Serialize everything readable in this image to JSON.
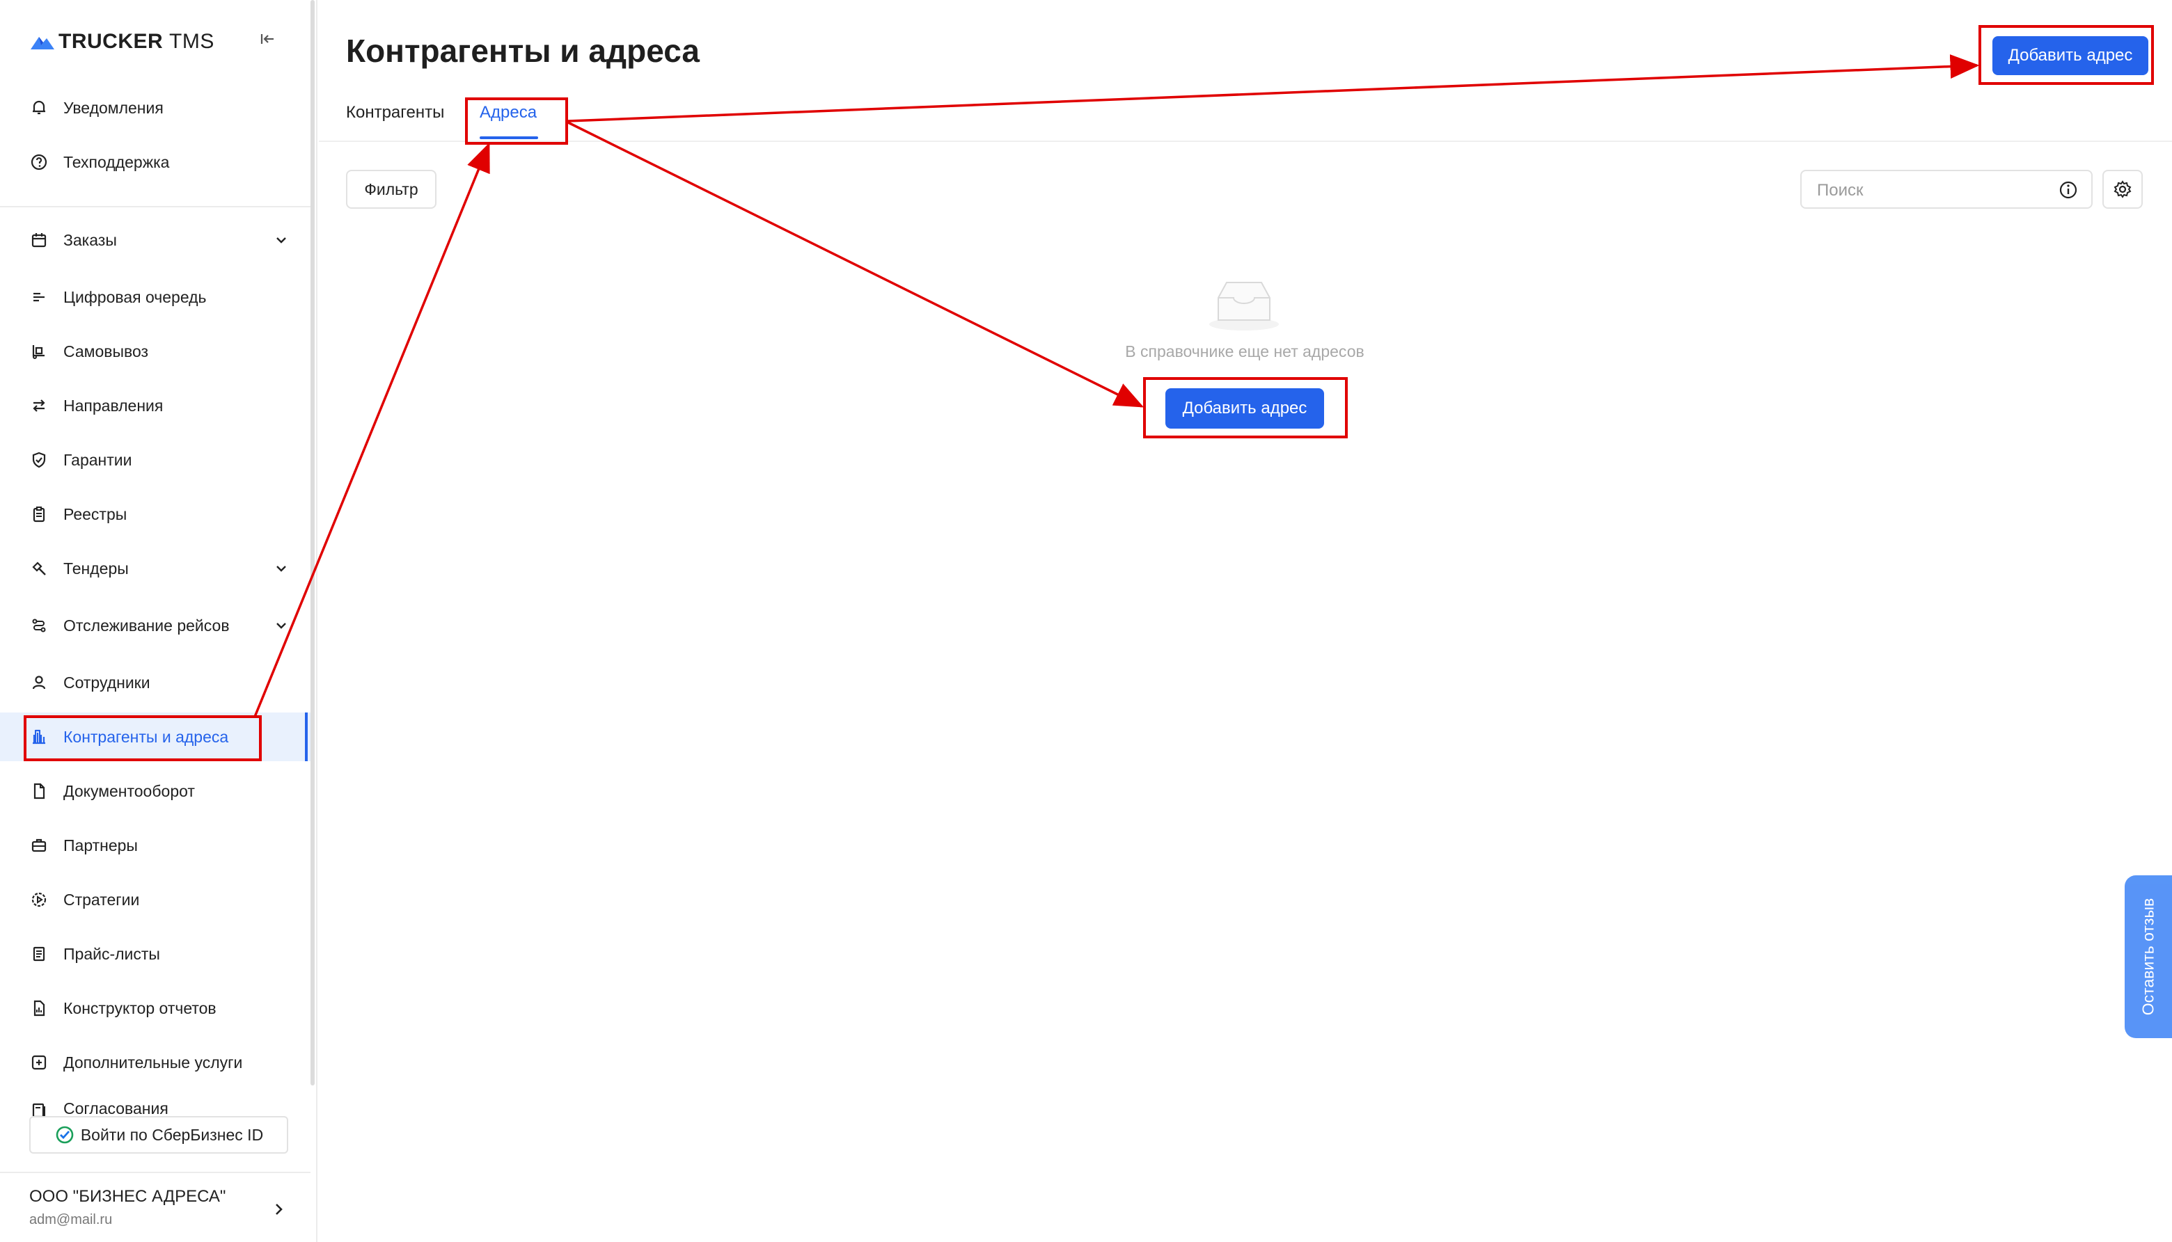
{
  "app": {
    "logo_brand": "TRUCKER",
    "logo_suffix": "TMS"
  },
  "sidebar": {
    "items": [
      {
        "label": "Уведомления",
        "icon": "bell-icon"
      },
      {
        "label": "Техподдержка",
        "icon": "help-circle-icon"
      },
      {
        "label": "Заказы",
        "icon": "calendar-icon"
      },
      {
        "label": "Цифровая очередь",
        "icon": "queue-icon"
      },
      {
        "label": "Самовывоз",
        "icon": "dolly-icon"
      },
      {
        "label": "Направления",
        "icon": "swap-arrows-icon"
      },
      {
        "label": "Гарантии",
        "icon": "shield-check-icon"
      },
      {
        "label": "Реестры",
        "icon": "clipboard-icon"
      },
      {
        "label": "Тендеры",
        "icon": "gavel-icon"
      },
      {
        "label": "Отслеживание рейсов",
        "icon": "route-icon"
      },
      {
        "label": "Сотрудники",
        "icon": "user-icon"
      },
      {
        "label": "Контрагенты и адреса",
        "icon": "bank-icon"
      },
      {
        "label": "Документооборот",
        "icon": "document-icon"
      },
      {
        "label": "Партнеры",
        "icon": "briefcase-icon"
      },
      {
        "label": "Стратегии",
        "icon": "gear-play-icon"
      },
      {
        "label": "Прайс-листы",
        "icon": "list-icon"
      },
      {
        "label": "Конструктор отчетов",
        "icon": "report-icon"
      },
      {
        "label": "Дополнительные услуги",
        "icon": "plus-square-icon"
      },
      {
        "label": "Согласования",
        "icon": "approval-icon"
      }
    ],
    "active_item": "Контрагенты и адреса",
    "sber_button": "Войти по СберБизнес ID",
    "org_name": "ООО \"БИЗНЕС АДРЕСА\"",
    "org_email": "adm@mail.ru"
  },
  "main": {
    "title": "Контрагенты и адреса",
    "tabs": [
      {
        "label": "Контрагенты",
        "active": false
      },
      {
        "label": "Адреса",
        "active": true
      }
    ],
    "add_button_top": "Добавить адрес",
    "filter_button": "Фильтр",
    "search_placeholder": "Поиск",
    "empty_text": "В справочнике еще нет адресов",
    "add_button_center": "Добавить адрес"
  },
  "feedback": {
    "label": "Оставить отзыв"
  },
  "colors": {
    "accent": "#2563eb",
    "annotation": "#e00000",
    "active_bg": "#e9f1fd"
  }
}
